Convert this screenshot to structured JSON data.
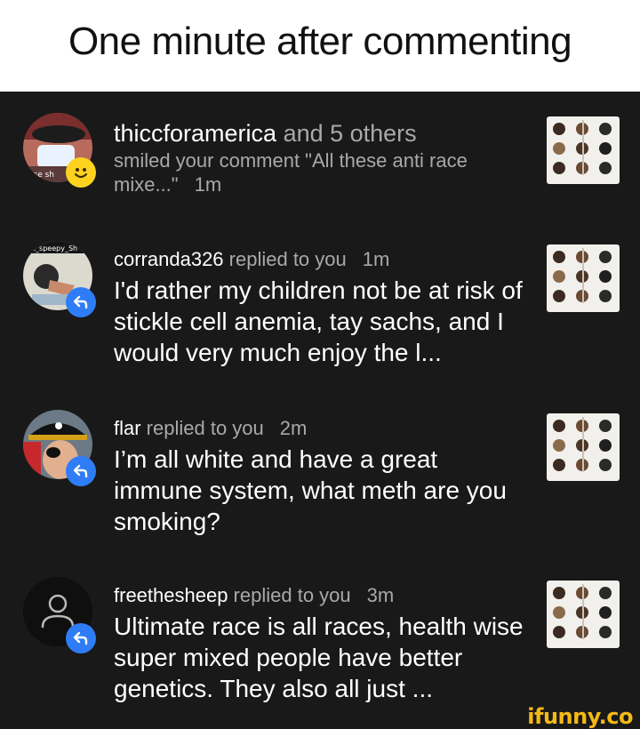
{
  "header": {
    "title": "One minute after commenting"
  },
  "notifications": [
    {
      "username": "thiccforamerica",
      "action": " and 5 others",
      "sub_text": "smiled your comment \"All these anti race mixe...\"",
      "time": "1m",
      "avatar_overlay_text": "ase sh",
      "badge": "smile-icon"
    },
    {
      "username": "corranda326",
      "action": " replied to you",
      "time": "1m",
      "body": "I'd rather my children not be at risk of stickle cell anemia, tay sachs, and I would very much enjoy the l...",
      "avatar_overlay_text": "at_speepy_Sh",
      "badge": "reply-icon"
    },
    {
      "username": "flar",
      "action": " replied to you",
      "time": "2m",
      "body": "I’m all white and have a great immune system, what meth are you smoking?",
      "badge": "reply-icon"
    },
    {
      "username": "freethesheep",
      "action": " replied to you",
      "time": "3m",
      "body": "Ultimate race is all races, health wise super mixed people have better genetics. They also all just ...",
      "badge": "reply-icon"
    }
  ],
  "watermark": "ifunny.co",
  "colors": {
    "background": "#191919",
    "muted": "#a9a9a9",
    "reply_badge": "#2f7df6",
    "smile_badge": "#ffd21f",
    "watermark": "#f5b914"
  }
}
